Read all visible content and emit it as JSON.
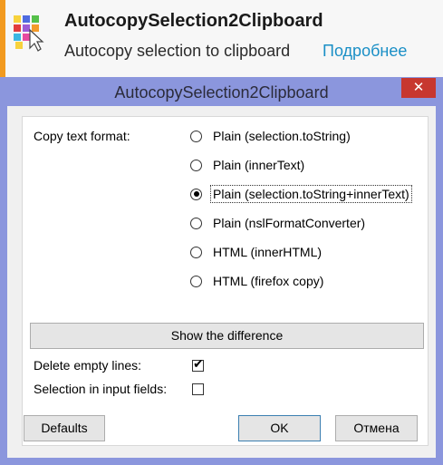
{
  "notification": {
    "title": "AutocopySelection2Clipboard",
    "description": "Autocopy selection to clipboard",
    "more_link": "Подробнее",
    "accent_color": "#f29a1f",
    "icon": "addon-icon"
  },
  "dialog": {
    "title": "AutocopySelection2Clipboard",
    "close_glyph": "✕",
    "titlebar_color": "#8b96dd",
    "close_color": "#c7372f",
    "format_label": "Copy text format:",
    "formats": [
      {
        "label": "Plain (selection.toString)",
        "checked": false
      },
      {
        "label": "Plain (innerText)",
        "checked": false
      },
      {
        "label": "Plain (selection.toString+innerText)",
        "checked": true
      },
      {
        "label": "Plain (nslFormatConverter)",
        "checked": false
      },
      {
        "label": "HTML (innerHTML)",
        "checked": false
      },
      {
        "label": "HTML (firefox copy)",
        "checked": false
      }
    ],
    "diff_button": "Show the difference",
    "delete_empty_lines": {
      "label": "Delete empty lines:",
      "checked": true
    },
    "selection_input": {
      "label": "Selection in input fields:",
      "checked": false
    },
    "buttons": {
      "defaults": "Defaults",
      "ok": "OK",
      "cancel": "Отмена"
    }
  }
}
